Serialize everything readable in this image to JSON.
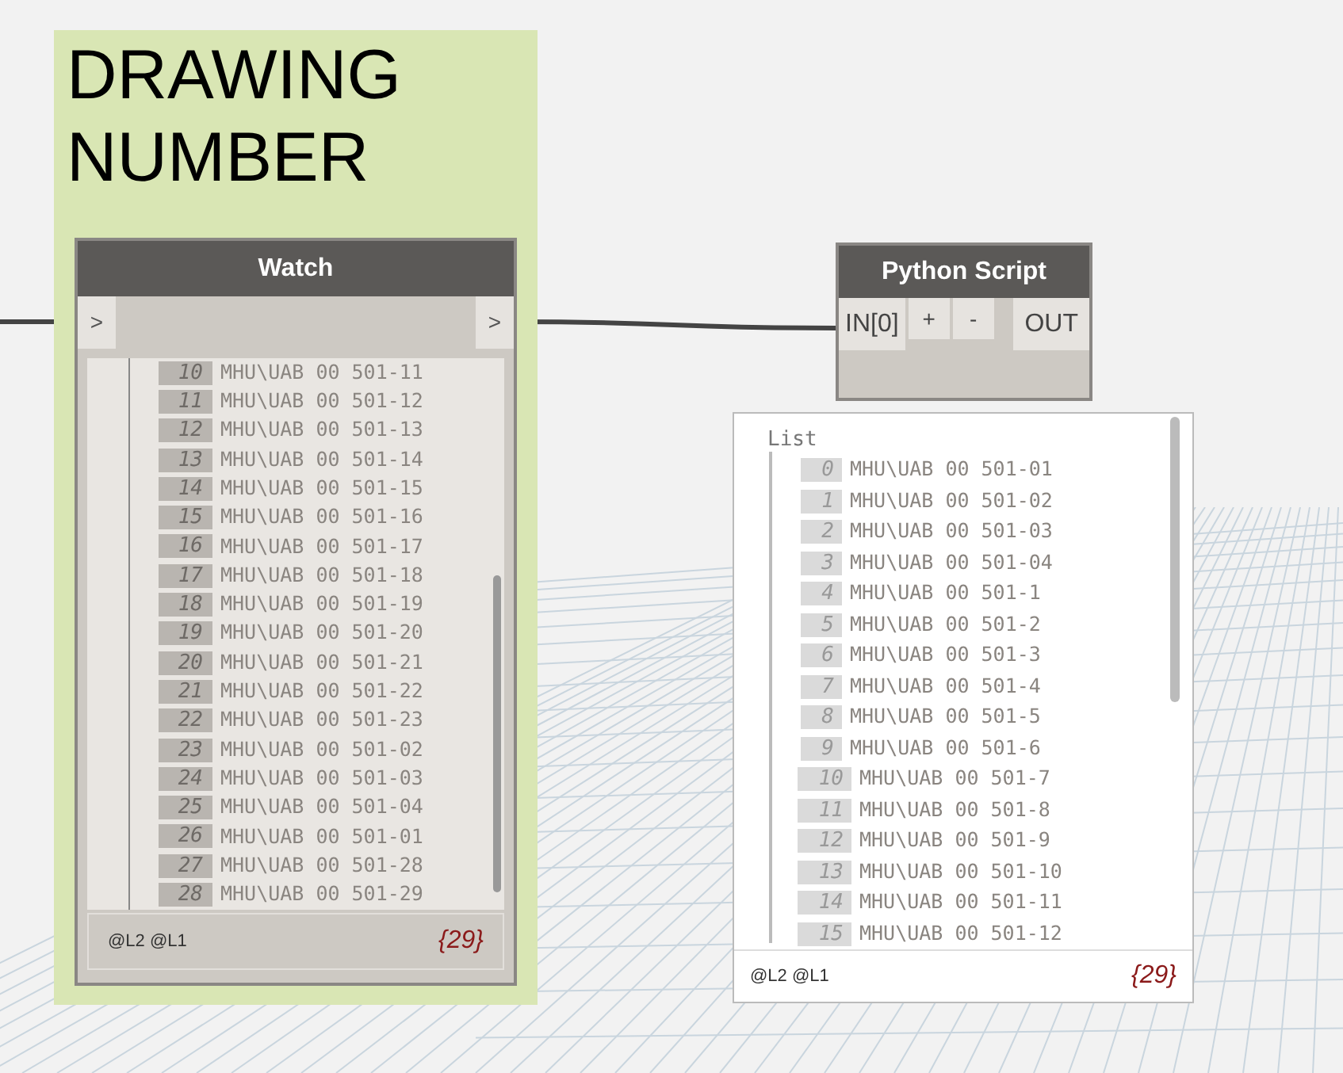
{
  "group": {
    "title": "DRAWING NUMBER"
  },
  "watch_node": {
    "title": "Watch",
    "input_port": ">",
    "output_port": ">",
    "rows": [
      {
        "index": "10",
        "value": "MHU\\UAB 00 501-11"
      },
      {
        "index": "11",
        "value": "MHU\\UAB 00 501-12"
      },
      {
        "index": "12",
        "value": "MHU\\UAB 00 501-13"
      },
      {
        "index": "13",
        "value": "MHU\\UAB 00 501-14"
      },
      {
        "index": "14",
        "value": "MHU\\UAB 00 501-15"
      },
      {
        "index": "15",
        "value": "MHU\\UAB 00 501-16"
      },
      {
        "index": "16",
        "value": "MHU\\UAB 00 501-17"
      },
      {
        "index": "17",
        "value": "MHU\\UAB 00 501-18"
      },
      {
        "index": "18",
        "value": "MHU\\UAB 00 501-19"
      },
      {
        "index": "19",
        "value": "MHU\\UAB 00 501-20"
      },
      {
        "index": "20",
        "value": "MHU\\UAB 00 501-21"
      },
      {
        "index": "21",
        "value": "MHU\\UAB 00 501-22"
      },
      {
        "index": "22",
        "value": "MHU\\UAB 00 501-23"
      },
      {
        "index": "23",
        "value": "MHU\\UAB 00 501-02"
      },
      {
        "index": "24",
        "value": "MHU\\UAB 00 501-03"
      },
      {
        "index": "25",
        "value": "MHU\\UAB 00 501-04"
      },
      {
        "index": "26",
        "value": "MHU\\UAB 00 501-01"
      },
      {
        "index": "27",
        "value": "MHU\\UAB 00 501-28"
      },
      {
        "index": "28",
        "value": "MHU\\UAB 00 501-29"
      }
    ],
    "levels": "@L2 @L1",
    "count": "{29}"
  },
  "python_node": {
    "title": "Python Script",
    "inputs": [
      "IN[0]"
    ],
    "buttons": [
      "+",
      "-"
    ],
    "outputs": [
      "OUT"
    ],
    "preview": {
      "header": "List",
      "rows": [
        {
          "index": "0",
          "value": "MHU\\UAB 00 501-01"
        },
        {
          "index": "1",
          "value": "MHU\\UAB 00 501-02"
        },
        {
          "index": "2",
          "value": "MHU\\UAB 00 501-03"
        },
        {
          "index": "3",
          "value": "MHU\\UAB 00 501-04"
        },
        {
          "index": "4",
          "value": "MHU\\UAB 00 501-1"
        },
        {
          "index": "5",
          "value": "MHU\\UAB 00 501-2"
        },
        {
          "index": "6",
          "value": "MHU\\UAB 00 501-3"
        },
        {
          "index": "7",
          "value": "MHU\\UAB 00 501-4"
        },
        {
          "index": "8",
          "value": "MHU\\UAB 00 501-5"
        },
        {
          "index": "9",
          "value": "MHU\\UAB 00 501-6"
        },
        {
          "index": "10",
          "value": "MHU\\UAB 00 501-7"
        },
        {
          "index": "11",
          "value": "MHU\\UAB 00 501-8"
        },
        {
          "index": "12",
          "value": "MHU\\UAB 00 501-9"
        },
        {
          "index": "13",
          "value": "MHU\\UAB 00 501-10"
        },
        {
          "index": "14",
          "value": "MHU\\UAB 00 501-11"
        },
        {
          "index": "15",
          "value": "MHU\\UAB 00 501-12"
        }
      ],
      "levels": "@L2 @L1",
      "count": "{29}"
    }
  }
}
